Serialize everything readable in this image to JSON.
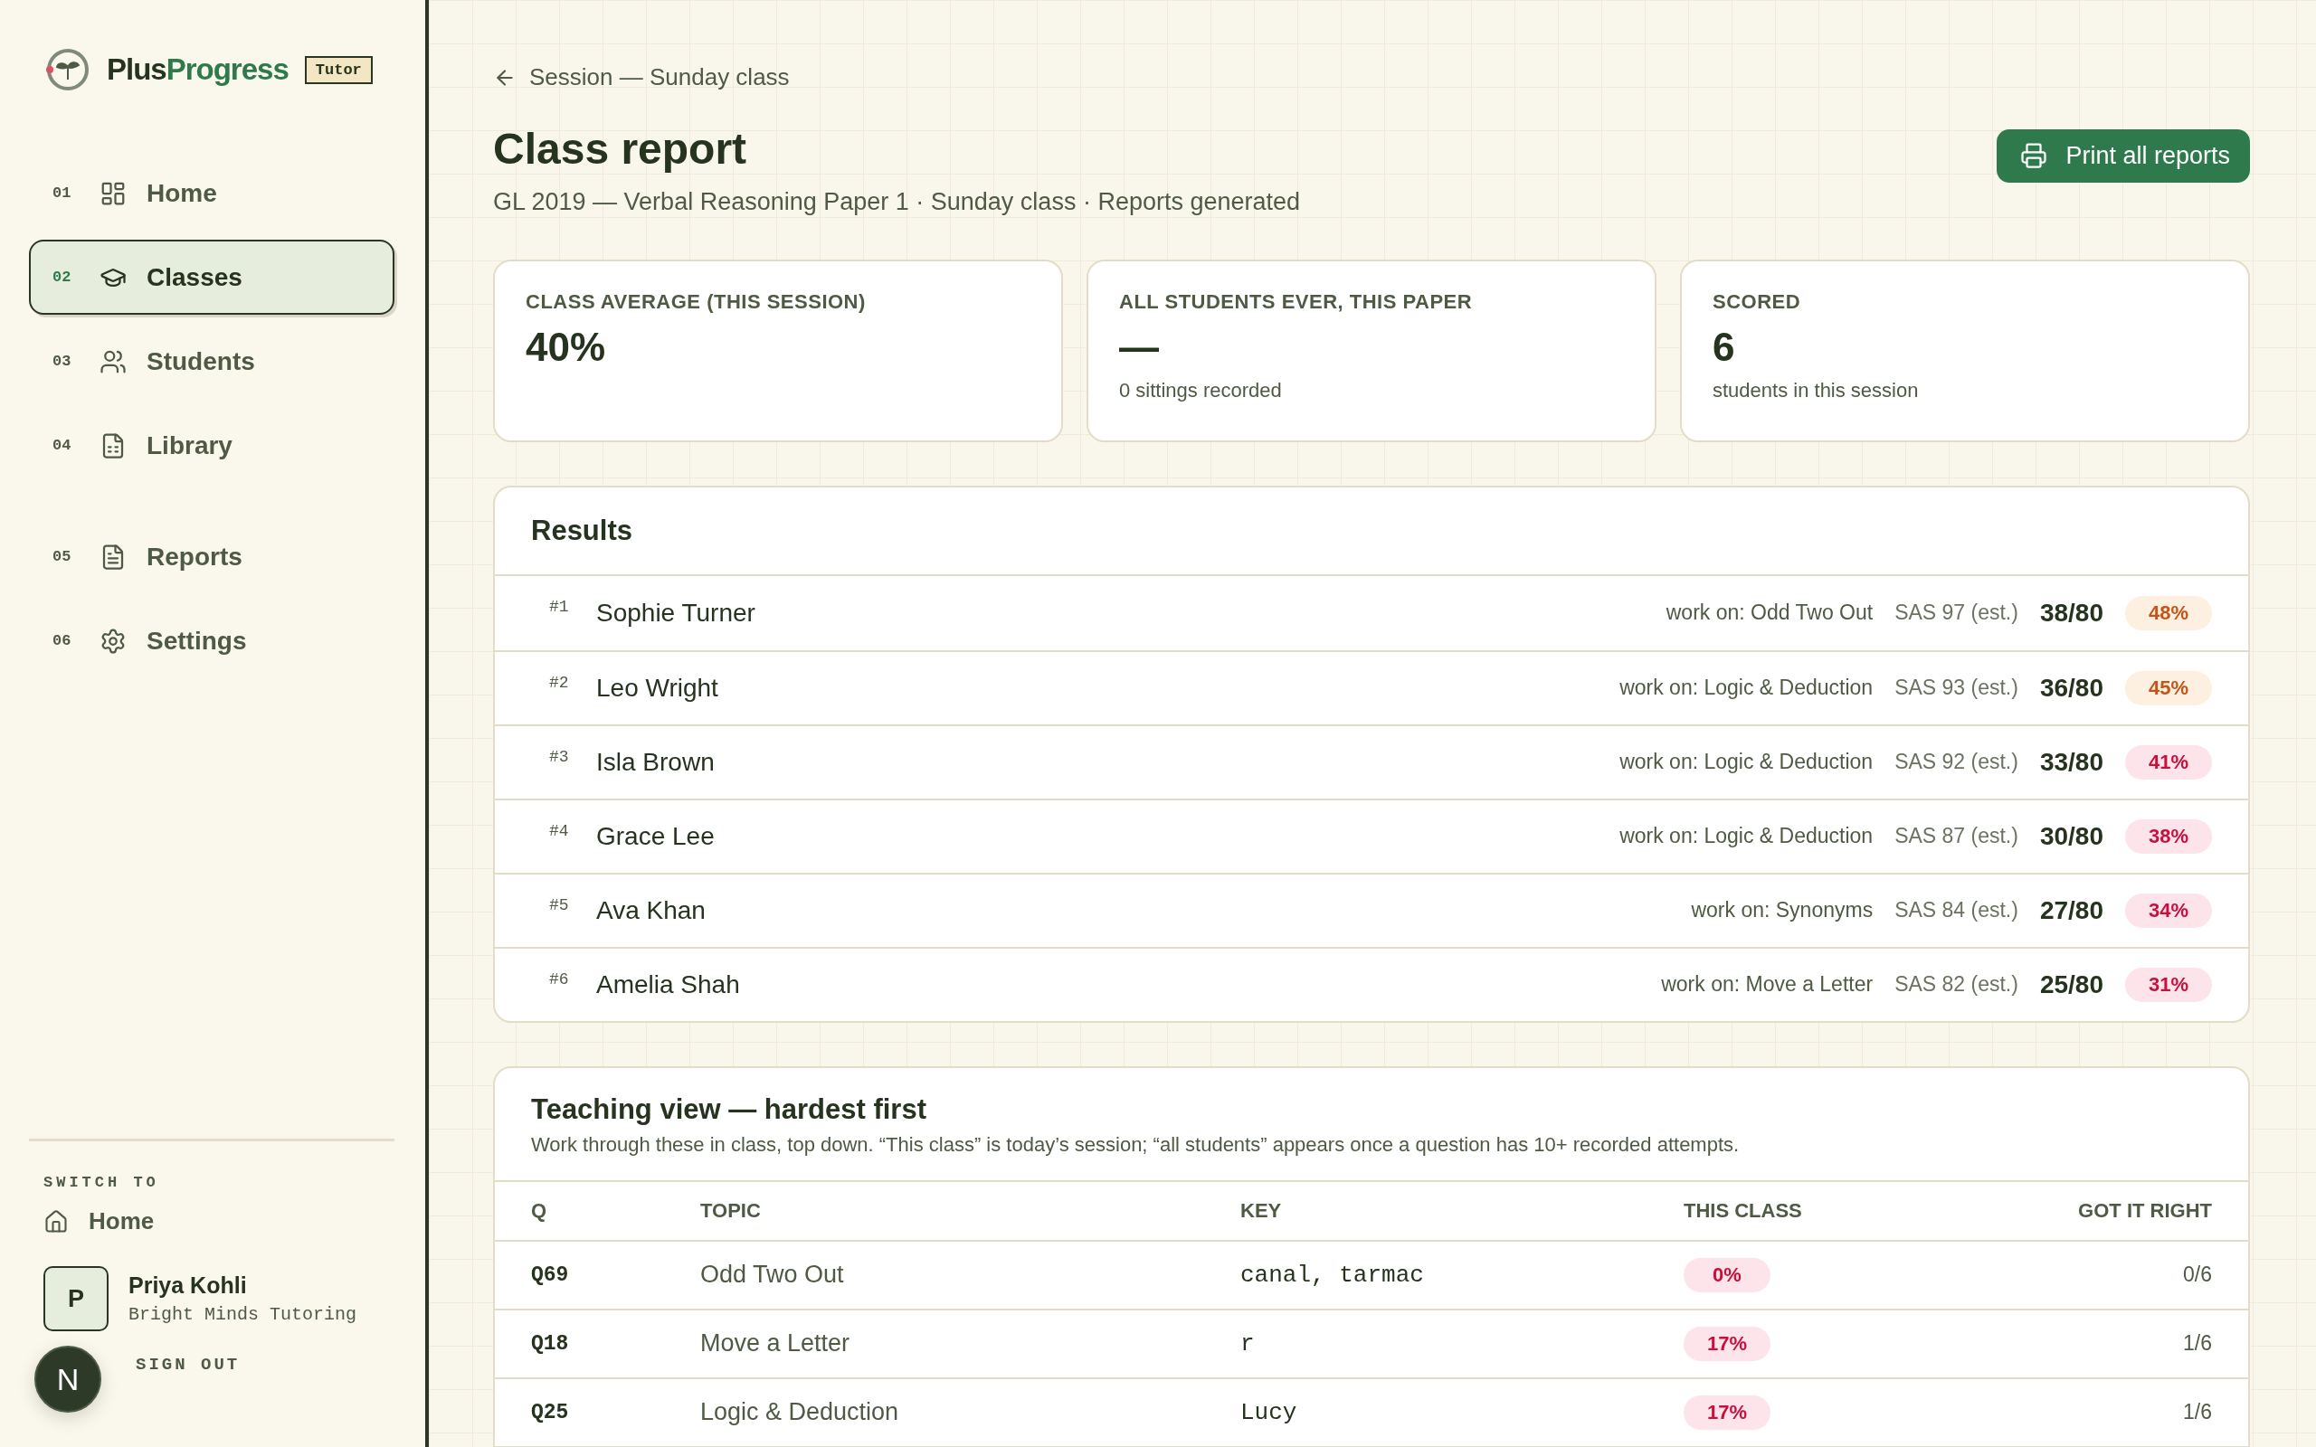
{
  "sidebar": {
    "brand": {
      "part_1": "Plus",
      "part_2": "Progress",
      "badge": "Tutor"
    },
    "nav_groups": [
      {
        "items": [
          {
            "number": "01",
            "label": "Home",
            "selected": false
          },
          {
            "number": "02",
            "label": "Classes",
            "selected": true
          },
          {
            "number": "03",
            "label": "Students",
            "selected": false
          },
          {
            "number": "04",
            "label": "Library",
            "selected": false
          }
        ]
      },
      {
        "items": [
          {
            "number": "05",
            "label": "Reports",
            "selected": false
          },
          {
            "number": "06",
            "label": "Settings",
            "selected": false
          }
        ]
      }
    ],
    "switch_to": {
      "heading": "SWITCH TO",
      "label": "Home"
    },
    "profile": {
      "initial": "P",
      "name": "Priya Kohli",
      "organisation": "Bright Minds Tutoring"
    },
    "sign_out": "SIGN OUT",
    "dev_badge": "N"
  },
  "header": {
    "back_link": "Session — Sunday class",
    "title": "Class report",
    "subtitle": "GL 2019 — Verbal Reasoning Paper 1 · Sunday class · Reports generated",
    "print_button": "Print all reports"
  },
  "stats": [
    {
      "label": "CLASS AVERAGE (THIS SESSION)",
      "value": "40%"
    },
    {
      "label": "ALL STUDENTS EVER, THIS PAPER",
      "value": "—",
      "note": "0 sittings recorded"
    },
    {
      "label": "SCORED",
      "value": "6",
      "note": "students in this session"
    }
  ],
  "results": {
    "title": "Results",
    "rows": [
      {
        "rank": "#1",
        "name": "Sophie Turner",
        "work_on": "work on: Odd Two Out",
        "sas": "SAS 97 (est.)",
        "score": "38/80",
        "percent": "48%",
        "kind": "moderate"
      },
      {
        "rank": "#2",
        "name": "Leo Wright",
        "work_on": "work on: Logic & Deduction",
        "sas": "SAS 93 (est.)",
        "score": "36/80",
        "percent": "45%",
        "kind": "moderate"
      },
      {
        "rank": "#3",
        "name": "Isla Brown",
        "work_on": "work on: Logic & Deduction",
        "sas": "SAS 92 (est.)",
        "score": "33/80",
        "percent": "41%",
        "kind": "low"
      },
      {
        "rank": "#4",
        "name": "Grace Lee",
        "work_on": "work on: Logic & Deduction",
        "sas": "SAS 87 (est.)",
        "score": "30/80",
        "percent": "38%",
        "kind": "low"
      },
      {
        "rank": "#5",
        "name": "Ava Khan",
        "work_on": "work on: Synonyms",
        "sas": "SAS 84 (est.)",
        "score": "27/80",
        "percent": "34%",
        "kind": "low"
      },
      {
        "rank": "#6",
        "name": "Amelia Shah",
        "work_on": "work on: Move a Letter",
        "sas": "SAS 82 (est.)",
        "score": "25/80",
        "percent": "31%",
        "kind": "low"
      }
    ]
  },
  "teaching_view": {
    "title": "Teaching view — hardest first",
    "description": "Work through these in class, top down. “This class” is today’s session; “all students” appears once a question has 10+ recorded attempts.",
    "columns": [
      "Q",
      "TOPIC",
      "KEY",
      "THIS CLASS",
      "GOT IT RIGHT"
    ],
    "rows": [
      {
        "q": "Q69",
        "topic": "Odd Two Out",
        "key": "canal, tarmac",
        "this_class": "0%",
        "got_it_right": "0/6"
      },
      {
        "q": "Q18",
        "topic": "Move a Letter",
        "key": "r",
        "this_class": "17%",
        "got_it_right": "1/6"
      },
      {
        "q": "Q25",
        "topic": "Logic & Deduction",
        "key": "Lucy",
        "this_class": "17%",
        "got_it_right": "1/6"
      }
    ]
  }
}
